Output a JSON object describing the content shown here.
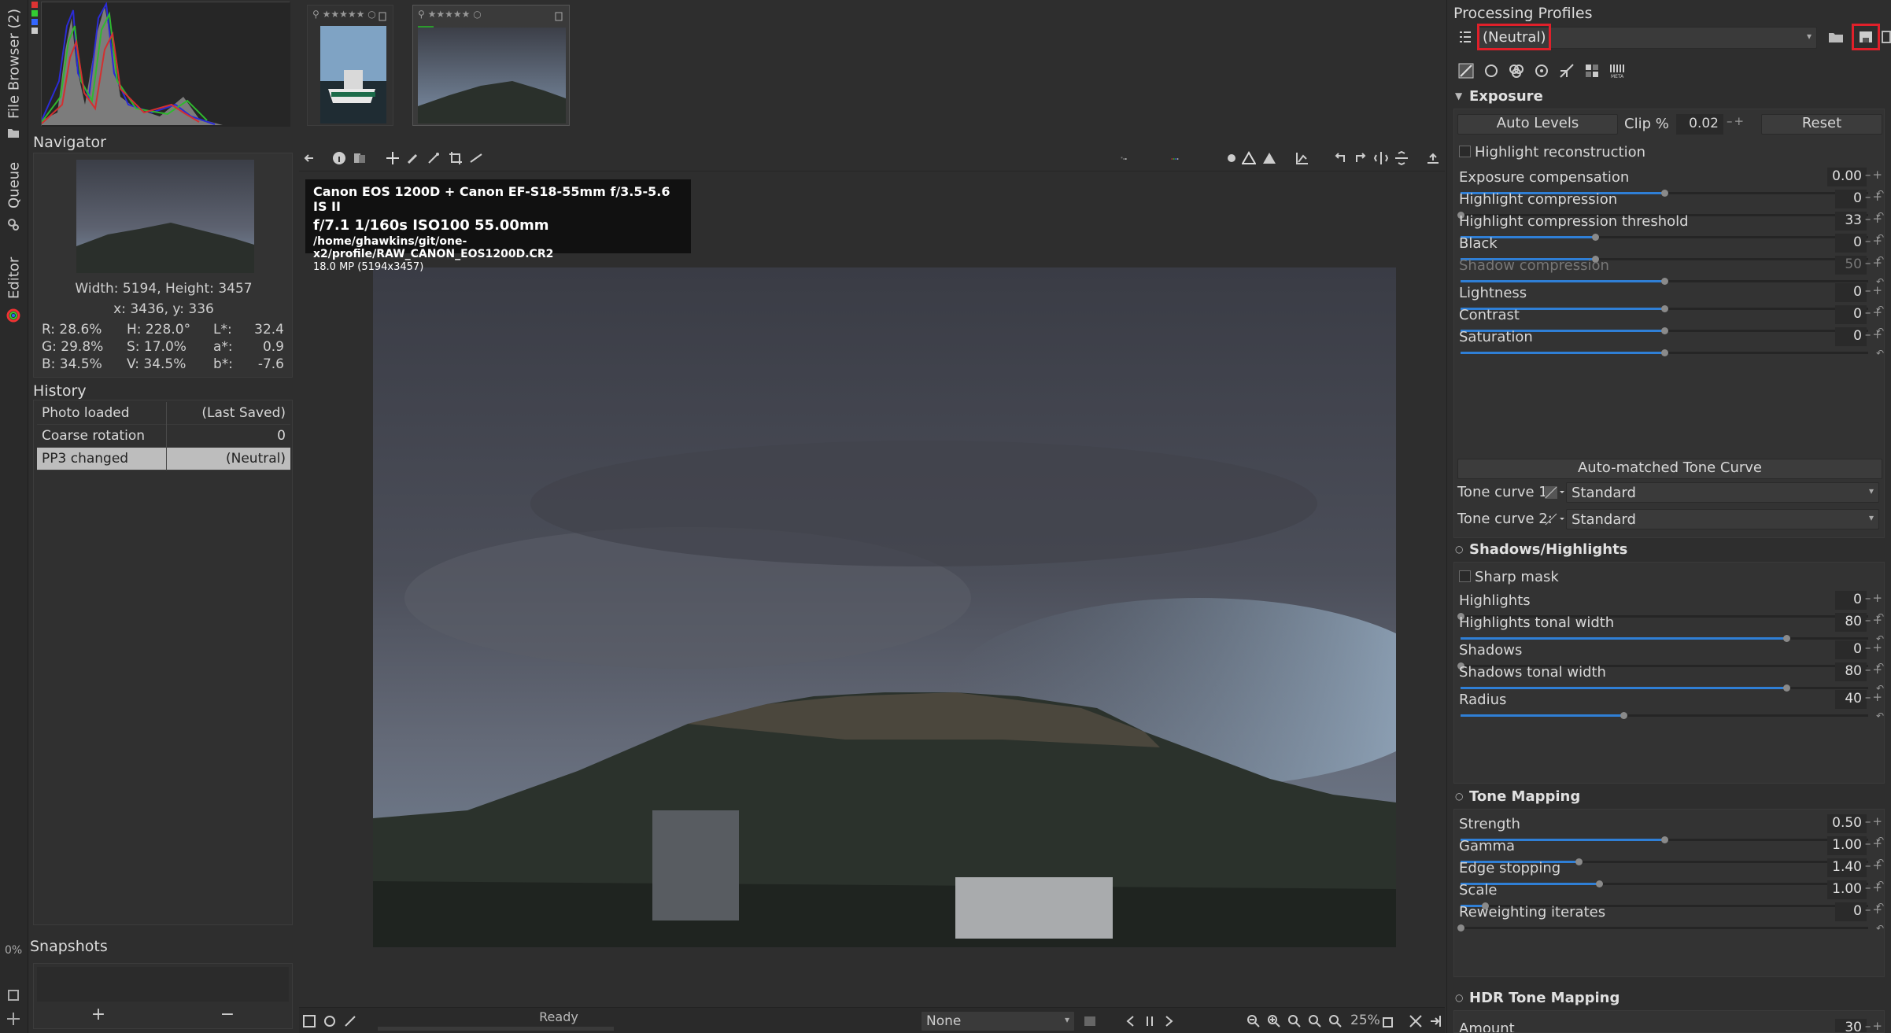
{
  "vtabs": {
    "file_browser": "File Browser (2)",
    "queue": "Queue",
    "editor": "Editor",
    "progress": "0%"
  },
  "navigator": {
    "title": "Navigator",
    "dimensions": "Width: 5194, Height: 3457",
    "coords": "x: 3436, y: 336",
    "r": "R: 28.6%",
    "g": "G: 29.8%",
    "b": "B: 34.5%",
    "h": "H: 228.0°",
    "s": "S: 17.0%",
    "v": "V: 34.5%",
    "l_label": "L*:",
    "l_val": "32.4",
    "a_label": "a*:",
    "a_val": "0.9",
    "bstar_label": "b*:",
    "bstar_val": "-7.6"
  },
  "history": {
    "title": "History",
    "rows": [
      {
        "action": "Photo loaded",
        "value": "(Last Saved)"
      },
      {
        "action": "Coarse rotation",
        "value": "0"
      },
      {
        "action": "PP3 changed",
        "value": "(Neutral)"
      }
    ]
  },
  "snapshots": {
    "title": "Snapshots",
    "add": "+",
    "remove": "−"
  },
  "image_info": {
    "camera": "Canon EOS 1200D + Canon EF-S18-55mm f/3.5-5.6 IS II",
    "exposure": "f/7.1  1/160s  ISO100  55.00mm",
    "path": "/home/ghawkins/git/one-x2/profile/RAW_CANON_EOS1200D.CR2",
    "size": "18.0 MP (5194x3457)"
  },
  "statusbar": {
    "status": "Ready",
    "preview_mode": "None",
    "zoom": "25%"
  },
  "profiles": {
    "title": "Processing Profiles",
    "selected": "(Neutral)"
  },
  "exposure": {
    "title": "Exposure",
    "auto_levels": "Auto Levels",
    "clip_label": "Clip %",
    "clip_value": "0.02",
    "reset": "Reset",
    "highlight_reconstruction": "Highlight reconstruction",
    "sliders": [
      {
        "label": "Exposure compensation",
        "value": "0.00",
        "pos": 0.5
      },
      {
        "label": "Highlight compression",
        "value": "0",
        "pos": 0.0
      },
      {
        "label": "Highlight compression threshold",
        "value": "33",
        "pos": 0.33
      },
      {
        "label": "Black",
        "value": "0",
        "pos": 0.33
      },
      {
        "label": "Shadow compression",
        "value": "50",
        "pos": 0.5,
        "disabled": true
      },
      {
        "label": "Lightness",
        "value": "0",
        "pos": 0.5
      },
      {
        "label": "Contrast",
        "value": "0",
        "pos": 0.5
      },
      {
        "label": "Saturation",
        "value": "0",
        "pos": 0.5
      }
    ],
    "auto_tone_curve": "Auto-matched Tone Curve",
    "tone_curve_1_label": "Tone curve 1:",
    "tone_curve_1_value": "Standard",
    "tone_curve_2_label": "Tone curve 2:",
    "tone_curve_2_value": "Standard"
  },
  "shadows_highlights": {
    "title": "Shadows/Highlights",
    "sharp_mask": "Sharp mask",
    "sliders": [
      {
        "label": "Highlights",
        "value": "0",
        "pos": 0.0
      },
      {
        "label": "Highlights tonal width",
        "value": "80",
        "pos": 0.8
      },
      {
        "label": "Shadows",
        "value": "0",
        "pos": 0.0
      },
      {
        "label": "Shadows tonal width",
        "value": "80",
        "pos": 0.8
      },
      {
        "label": "Radius",
        "value": "40",
        "pos": 0.4
      }
    ]
  },
  "tone_mapping": {
    "title": "Tone Mapping",
    "sliders": [
      {
        "label": "Strength",
        "value": "0.50",
        "pos": 0.5
      },
      {
        "label": "Gamma",
        "value": "1.00",
        "pos": 0.29
      },
      {
        "label": "Edge stopping",
        "value": "1.40",
        "pos": 0.34
      },
      {
        "label": "Scale",
        "value": "1.00",
        "pos": 0.06
      },
      {
        "label": "Reweighting iterates",
        "value": "0",
        "pos": 0.0
      }
    ]
  },
  "hdr_tone_mapping": {
    "title": "HDR Tone Mapping",
    "amount_label": "Amount",
    "amount_value": "30"
  },
  "colors": {
    "accent": "#2f7fd6",
    "highlight_box": "#e0202a",
    "check_green": "#2c9a2c"
  }
}
